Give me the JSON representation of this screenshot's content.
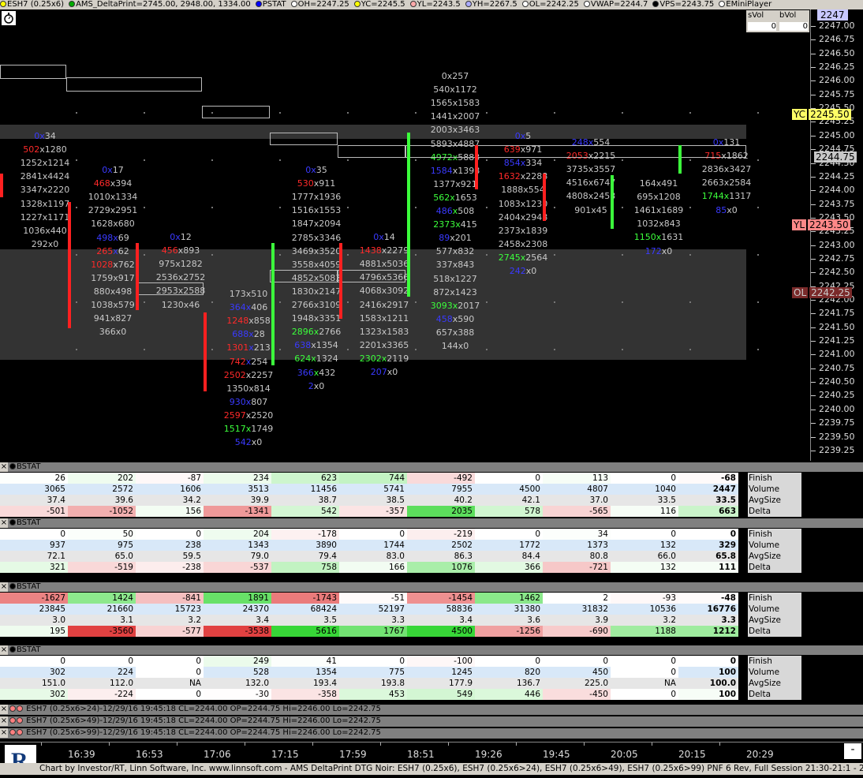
{
  "topbar": {
    "items": [
      {
        "label": "ESH7 (0.25x6)",
        "color": "#ffff00"
      },
      {
        "label": "AMS_DeltaPrint=2745.00, 2948.00, 1334.00",
        "color": "#00aa00"
      },
      {
        "label": "PSTAT",
        "color": "#0000ff"
      },
      {
        "label": "OH=2247.25",
        "color": "#ffffff"
      },
      {
        "label": "YC=2245.5",
        "color": "#ffff00"
      },
      {
        "label": "YL=2243.5",
        "color": "#ffaaaa"
      },
      {
        "label": "YH=2267.5",
        "color": "#aaaaff"
      },
      {
        "label": "OL=2242.25",
        "color": "#ffffff"
      },
      {
        "label": "VWAP=2244.7",
        "color": "#ffffff"
      },
      {
        "label": "VPS=2243.75",
        "color": "#000000"
      },
      {
        "label": "EMiniPlayer",
        "color": "#ffffff"
      }
    ]
  },
  "svol": {
    "h1": "sVol",
    "h2": "bVol",
    "v1": "0",
    "v2": "0"
  },
  "scale": {
    "top_label": "2247",
    "ticks": [
      "2247.00",
      "2246.75",
      "2246.50",
      "2246.25",
      "2246.00",
      "2245.75",
      "2245.50",
      "2245.25",
      "2245.00",
      "2244.75",
      "2244.50",
      "2244.25",
      "2244.00",
      "2243.75",
      "2243.50",
      "2243.25",
      "2243.00",
      "2242.75",
      "2242.50",
      "2242.25",
      "2242.00",
      "2241.75",
      "2241.50",
      "2241.25",
      "2241.00",
      "2240.75",
      "2240.50",
      "2240.25",
      "2240.00",
      "2239.75",
      "2239.50",
      "2239.25"
    ],
    "tags": [
      {
        "name": "YC",
        "value": "2245.50",
        "bg": "#ffff66",
        "fg": "#000"
      },
      {
        "name": "",
        "value": "2244.75",
        "bg": "#c8c8c8",
        "fg": "#000"
      },
      {
        "name": "YL",
        "value": "2243.50",
        "bg": "#ff8888",
        "fg": "#000"
      },
      {
        "name": "OL",
        "value": "2242.25",
        "bg": "#7a2a2a",
        "fg": "#ccc"
      }
    ]
  },
  "columns": [
    {
      "cells": [
        [
          "0x",
          "bl",
          "34"
        ],
        [
          "502",
          "rd",
          "x1280"
        ],
        [
          "1252x1214"
        ],
        [
          "2841x4424"
        ],
        [
          "3347x2220"
        ],
        [
          "1328x1197"
        ],
        [
          "1227x1171"
        ],
        [
          "1036x440"
        ],
        [
          "292x0"
        ]
      ]
    },
    {
      "cells": [
        [
          "0x",
          "bl",
          "17"
        ],
        [
          "468",
          "rd",
          "x394"
        ],
        [
          "1010x1334"
        ],
        [
          "2729x2951"
        ],
        [
          "1628x680"
        ],
        [
          "498x",
          "bl",
          "69"
        ],
        [
          "265",
          "rd",
          "x",
          "bl",
          "62"
        ],
        [
          "1028",
          "rd",
          "x762"
        ],
        [
          "1759x917"
        ],
        [
          "880x498"
        ],
        [
          "1038x579"
        ],
        [
          "941x827"
        ],
        [
          "366x0"
        ]
      ]
    },
    {
      "cells": [
        [
          "0x",
          "bl",
          "12"
        ],
        [
          "456",
          "rd",
          "x893"
        ],
        [
          "975x1282"
        ],
        [
          "2536x2752"
        ],
        [
          "2953x2588"
        ],
        [
          "1230x46"
        ]
      ]
    },
    {
      "cells": [
        [
          "173x510"
        ],
        [
          "364x",
          "bl",
          "406"
        ],
        [
          "1248",
          "rd",
          "x858"
        ],
        [
          "688x",
          "bl",
          "28"
        ],
        [
          "1301",
          "rd",
          "x",
          "bl",
          "213"
        ],
        [
          "742",
          "rd",
          "x",
          "bl",
          "254"
        ],
        [
          "2502",
          "rd",
          "x2257"
        ],
        [
          "1350x814"
        ],
        [
          "930x",
          "bl",
          "807"
        ],
        [
          "2597",
          "rd",
          "x2520"
        ],
        [
          "1517x",
          "gr",
          "1749"
        ],
        [
          "542",
          "bl",
          "x0"
        ]
      ]
    },
    {
      "cells": [
        [
          "0x",
          "bl",
          "35"
        ],
        [
          "530",
          "rd",
          "x911"
        ],
        [
          "1777x1936"
        ],
        [
          "1516x1553"
        ],
        [
          "1847x2094"
        ],
        [
          "2785x3346"
        ],
        [
          "3469x3520"
        ],
        [
          "3558x4059"
        ],
        [
          "4852x5083"
        ],
        [
          "1830x2147"
        ],
        [
          "2766x3109"
        ],
        [
          "1948x3351"
        ],
        [
          "2896x",
          "gr",
          "2766"
        ],
        [
          "638",
          "bl",
          "x1354"
        ],
        [
          "624x",
          "gr",
          "1324"
        ],
        [
          "366",
          "bl",
          "x",
          "gr",
          "432"
        ],
        [
          "2",
          "bl",
          "x0"
        ]
      ]
    },
    {
      "cells": [
        [
          "0x",
          "bl",
          "14"
        ],
        [
          "1438",
          "rd",
          "x2279"
        ],
        [
          "4881x5036"
        ],
        [
          "4796x5366"
        ],
        [
          "4068x3092"
        ],
        [
          "2416x2917"
        ],
        [
          "1583x1211"
        ],
        [
          "1323x1583"
        ],
        [
          "2201x3365"
        ],
        [
          "2302x",
          "gr",
          "2119"
        ],
        [
          "207",
          "bl",
          "x0"
        ]
      ]
    },
    {
      "cells": [
        [
          "0x257"
        ],
        [
          "540x1172"
        ],
        [
          "1565x1583"
        ],
        [
          "1441x2007"
        ],
        [
          "2003x3463"
        ],
        [
          "5893x4887"
        ],
        [
          "4972x",
          "gr",
          "5883"
        ],
        [
          "1584",
          "bl",
          "x1398"
        ],
        [
          "1377x921"
        ],
        [
          "562x",
          "gr",
          "1653"
        ],
        [
          "486",
          "bl",
          "x",
          "gr",
          "508"
        ],
        [
          "2373x",
          "gr",
          "415"
        ],
        [
          "89",
          "bl",
          "x201"
        ],
        [
          "577x832"
        ],
        [
          "337x843"
        ],
        [
          "518x1227"
        ],
        [
          "872x1423"
        ],
        [
          "3093x",
          "gr",
          "2017"
        ],
        [
          "458",
          "bl",
          "x590"
        ],
        [
          "657x388"
        ],
        [
          "144x0"
        ]
      ]
    },
    {
      "cells": [
        [
          "0x",
          "bl",
          "5"
        ],
        [
          "639",
          "rd",
          "x971"
        ],
        [
          "854x",
          "bl",
          "334"
        ],
        [
          "1632",
          "rd",
          "x2288"
        ],
        [
          "1888x554"
        ],
        [
          "1083x1230"
        ],
        [
          "2404x2948"
        ],
        [
          "2373x1839"
        ],
        [
          "2458x2308"
        ],
        [
          "2745x",
          "gr",
          "2564"
        ],
        [
          "242",
          "bl",
          "x0"
        ]
      ]
    },
    {
      "cells": [
        [
          "248x",
          "bl",
          "554"
        ],
        [
          "2053",
          "rd",
          "x2215"
        ],
        [
          "3735x3557"
        ],
        [
          "4516x6747"
        ],
        [
          "4808x2453"
        ],
        [
          "901x45"
        ]
      ]
    },
    {
      "cells": [
        [
          "164x491"
        ],
        [
          "695x1208"
        ],
        [
          "1461x1689"
        ],
        [
          "1032x843"
        ],
        [
          "1150x",
          "gr",
          "1631"
        ],
        [
          "172",
          "bl",
          "x0"
        ]
      ]
    },
    {
      "cells": [
        [
          "0x",
          "bl",
          "131"
        ],
        [
          "715",
          "rd",
          "x1862"
        ],
        [
          "2836x3427"
        ],
        [
          "2663x2584"
        ],
        [
          "1744x",
          "gr",
          "1317"
        ],
        [
          "85",
          "bl",
          "x0"
        ]
      ]
    }
  ],
  "panels": [
    {
      "title": "BSTAT",
      "rows": [
        {
          "label": "Finish",
          "vals": [
            "26",
            "202",
            "-87",
            "234",
            "623",
            "744",
            "-492",
            "0",
            "113",
            "0",
            "-68"
          ]
        },
        {
          "label": "Volume",
          "vals": [
            "3065",
            "2572",
            "1606",
            "3513",
            "11456",
            "5741",
            "7955",
            "4500",
            "4807",
            "1040",
            "2447"
          ]
        },
        {
          "label": "AvgSize",
          "vals": [
            "37.4",
            "39.6",
            "34.2",
            "39.9",
            "38.7",
            "38.5",
            "40.2",
            "42.1",
            "37.0",
            "33.5",
            "33.5"
          ]
        },
        {
          "label": "Delta",
          "vals": [
            "-501",
            "-1052",
            "156",
            "-1341",
            "542",
            "-357",
            "2035",
            "578",
            "-565",
            "116",
            "663"
          ]
        }
      ]
    },
    {
      "title": "BSTAT",
      "rows": [
        {
          "label": "Finish",
          "vals": [
            "0",
            "50",
            "0",
            "204",
            "-178",
            "0",
            "-219",
            "0",
            "34",
            "0",
            "0"
          ]
        },
        {
          "label": "Volume",
          "vals": [
            "937",
            "975",
            "238",
            "1343",
            "3890",
            "1744",
            "2502",
            "1772",
            "1373",
            "132",
            "329"
          ]
        },
        {
          "label": "AvgSize",
          "vals": [
            "72.1",
            "65.0",
            "59.5",
            "79.0",
            "79.4",
            "83.0",
            "86.3",
            "84.4",
            "80.8",
            "66.0",
            "65.8"
          ]
        },
        {
          "label": "Delta",
          "vals": [
            "321",
            "-519",
            "-238",
            "-537",
            "758",
            "166",
            "1076",
            "366",
            "-721",
            "132",
            "111"
          ]
        }
      ]
    },
    {
      "title": "BSTAT",
      "rows": [
        {
          "label": "Finish",
          "vals": [
            "-1627",
            "1424",
            "-841",
            "1891",
            "-1743",
            "-51",
            "-1454",
            "1462",
            "2",
            "-93",
            "-48"
          ]
        },
        {
          "label": "Volume",
          "vals": [
            "23845",
            "21660",
            "15723",
            "24370",
            "68424",
            "52197",
            "58836",
            "31380",
            "31832",
            "10536",
            "16776"
          ]
        },
        {
          "label": "AvgSize",
          "vals": [
            "3.0",
            "3.1",
            "3.2",
            "3.4",
            "3.5",
            "3.3",
            "3.4",
            "3.6",
            "3.9",
            "3.2",
            "3.3"
          ]
        },
        {
          "label": "Delta",
          "vals": [
            "195",
            "-3560",
            "-577",
            "-3538",
            "5616",
            "1767",
            "4500",
            "-1256",
            "-690",
            "1188",
            "1212"
          ]
        }
      ]
    },
    {
      "title": "BSTAT",
      "rows": [
        {
          "label": "Finish",
          "vals": [
            "0",
            "0",
            "0",
            "249",
            "41",
            "0",
            "-100",
            "0",
            "0",
            "0",
            "0"
          ]
        },
        {
          "label": "Volume",
          "vals": [
            "302",
            "224",
            "0",
            "528",
            "1354",
            "775",
            "1245",
            "820",
            "450",
            "0",
            "100"
          ]
        },
        {
          "label": "AvgSize",
          "vals": [
            "151.0",
            "112.0",
            "NA",
            "132.0",
            "193.4",
            "193.8",
            "177.9",
            "136.7",
            "225.0",
            "NA",
            "100.0"
          ]
        },
        {
          "label": "Delta",
          "vals": [
            "302",
            "-224",
            "0",
            "-30",
            "-358",
            "453",
            "549",
            "446",
            "-450",
            "0",
            "100"
          ]
        }
      ]
    }
  ],
  "instruments": [
    "ESH7 (0.25x6>24)-12/29/16 19:45:18 CL=2244.00 OP=2244.75 Hi=2246.00 Lo=2242.75",
    "ESH7 (0.25x6>49)-12/29/16 19:45:18 CL=2244.00 OP=2244.75 Hi=2246.00 Lo=2242.75",
    "ESH7 (0.25x6>99)-12/29/16 19:45:18 CL=2244.00 OP=2244.75 Hi=2246.00 Lo=2242.75"
  ],
  "times": [
    "16:39",
    "16:53",
    "17:06",
    "17:15",
    "17:59",
    "18:51",
    "19:26",
    "19:45",
    "20:05",
    "20:15",
    "20:29"
  ],
  "footer": "Chart by Investor/RT, Linn Software, Inc. www.linnsoft.com - AMS DeltaPrint DTG Noir: ESH7 (0.25x6), ESH7 (0.25x6>24), ESH7 (0.25x6>49), ESH7 (0.25x6>99) PNF 6 Rev, Full Session 21:30-21:1 - 2016-12-29 20:",
  "minus_button": "-"
}
